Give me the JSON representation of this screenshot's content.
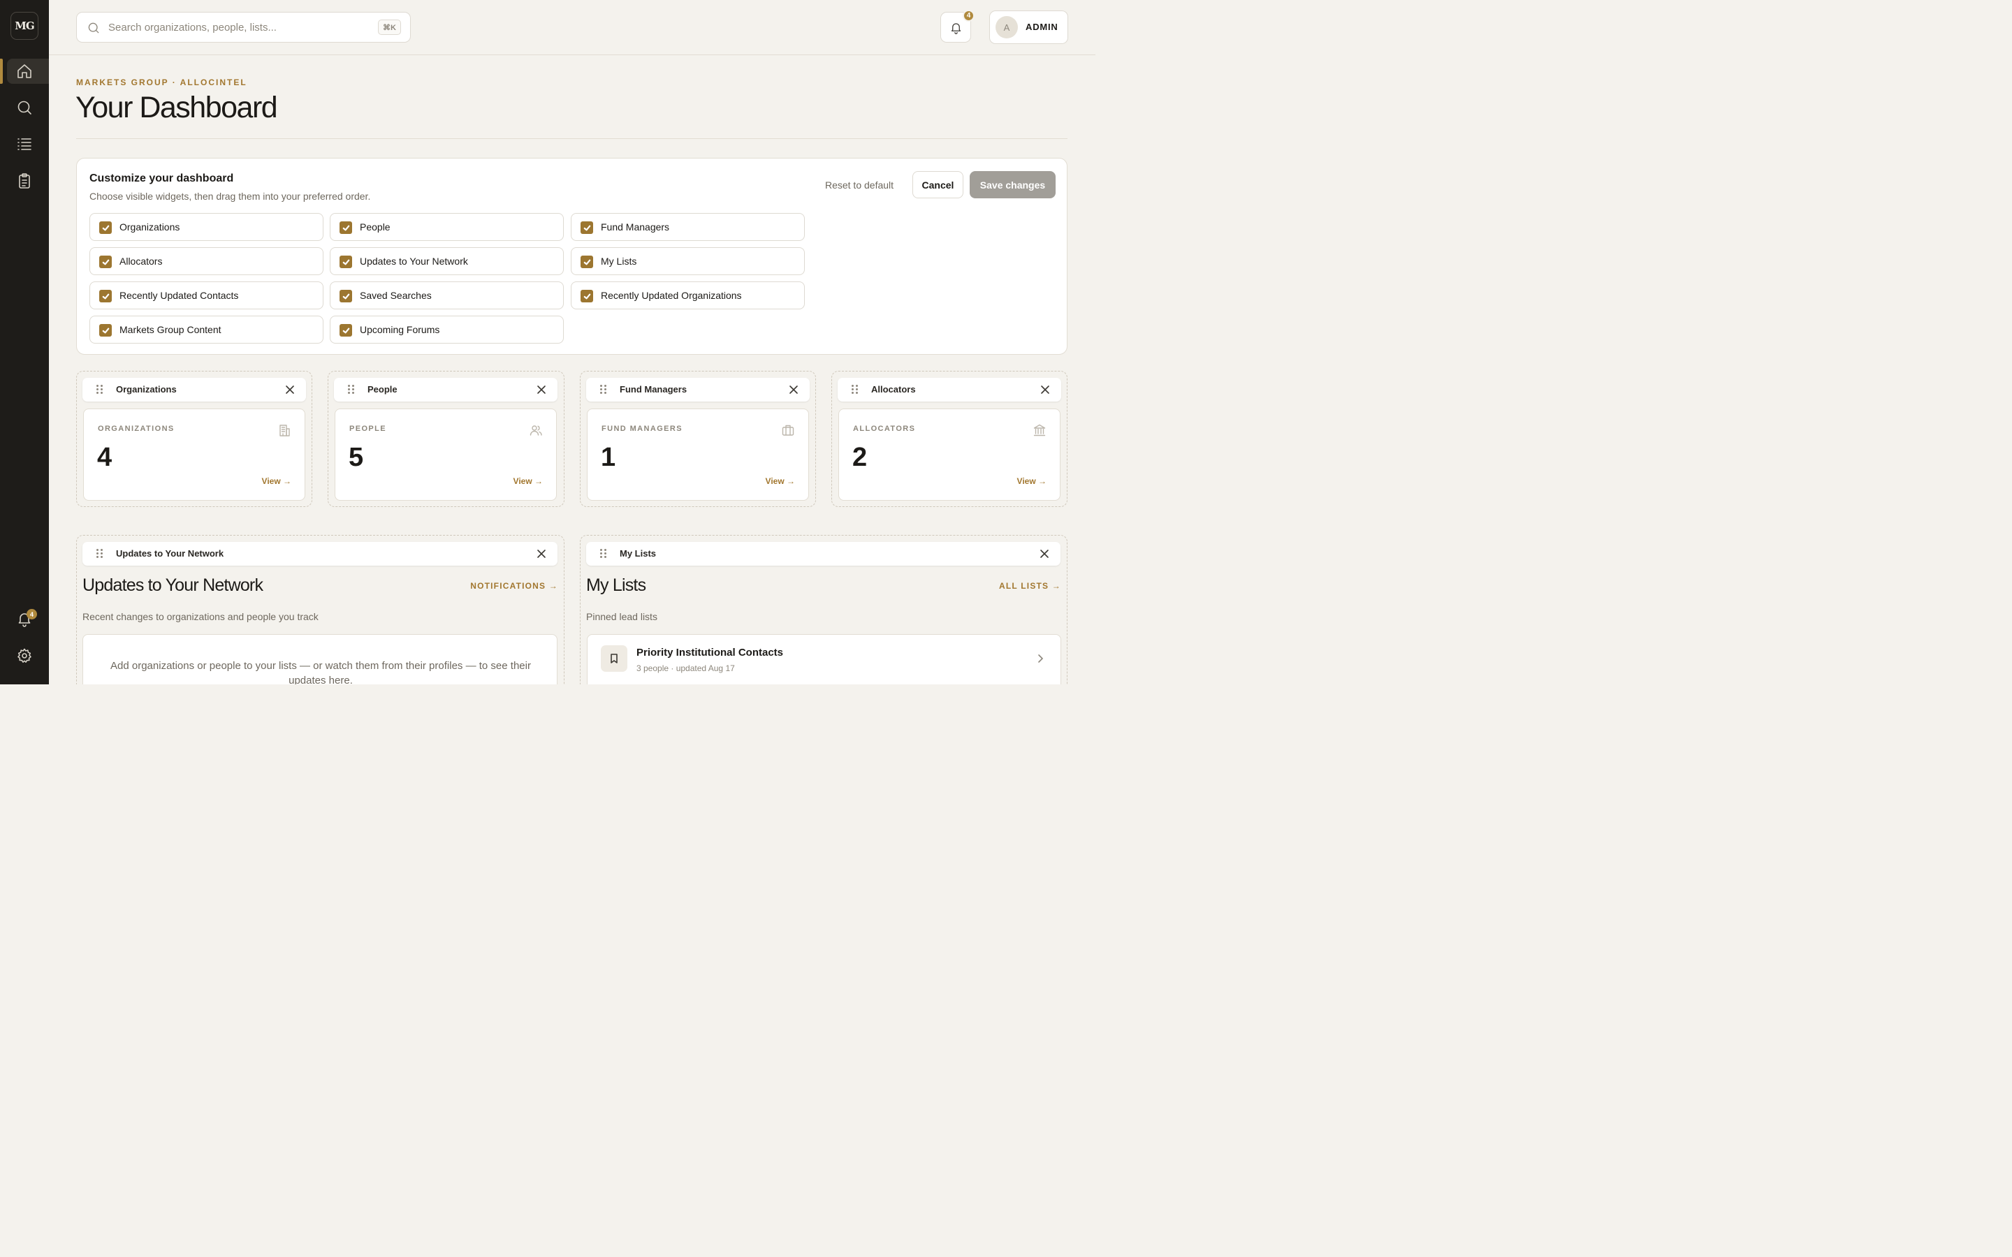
{
  "sidebar": {
    "logo": "MG",
    "notification_count": "4"
  },
  "topbar": {
    "search_placeholder": "Search organizations, people, lists...",
    "search_shortcut": "⌘K",
    "notification_count": "4",
    "avatar_initial": "A",
    "user_label": "ADMIN"
  },
  "header": {
    "eyebrow": "MARKETS GROUP · ALLOCINTEL",
    "title": "Your Dashboard"
  },
  "customize": {
    "title": "Customize your dashboard",
    "subtitle": "Choose visible widgets, then drag them into your preferred order.",
    "reset_label": "Reset to default",
    "cancel_label": "Cancel",
    "save_label": "Save changes",
    "options": [
      {
        "label": "Organizations",
        "checked": true
      },
      {
        "label": "People",
        "checked": true
      },
      {
        "label": "Fund Managers",
        "checked": true
      },
      {
        "label": "Allocators",
        "checked": true
      },
      {
        "label": "Updates to Your Network",
        "checked": true
      },
      {
        "label": "My Lists",
        "checked": true
      },
      {
        "label": "Recently Updated Contacts",
        "checked": true
      },
      {
        "label": "Saved Searches",
        "checked": true
      },
      {
        "label": "Recently Updated Organizations",
        "checked": true
      },
      {
        "label": "Markets Group Content",
        "checked": true
      },
      {
        "label": "Upcoming Forums",
        "checked": true
      }
    ]
  },
  "stats": [
    {
      "bar_title": "Organizations",
      "label": "ORGANIZATIONS",
      "value": "4",
      "link": "View →",
      "icon": "building-icon"
    },
    {
      "bar_title": "People",
      "label": "PEOPLE",
      "value": "5",
      "link": "View →",
      "icon": "users-icon"
    },
    {
      "bar_title": "Fund Managers",
      "label": "FUND MANAGERS",
      "value": "1",
      "link": "View →",
      "icon": "briefcase-icon"
    },
    {
      "bar_title": "Allocators",
      "label": "ALLOCATORS",
      "value": "2",
      "link": "View →",
      "icon": "bank-icon"
    }
  ],
  "updates_widget": {
    "bar_title": "Updates to Your Network",
    "title": "Updates to Your Network",
    "link": "NOTIFICATIONS →",
    "subtitle": "Recent changes to organizations and people you track",
    "empty_text": "Add organizations or people to your lists — or watch them from their profiles — to see their updates here."
  },
  "lists_widget": {
    "bar_title": "My Lists",
    "title": "My Lists",
    "link": "ALL LISTS →",
    "subtitle": "Pinned lead lists",
    "items": [
      {
        "name": "Priority Institutional Contacts",
        "meta": "3 people · updated Aug 17"
      }
    ]
  },
  "colors": {
    "accent": "#a2772f",
    "sidebar_bg": "#1e1c19",
    "page_bg": "#f4f2ed",
    "checkbox": "#9c7630",
    "save_disabled": "#a19e98"
  }
}
